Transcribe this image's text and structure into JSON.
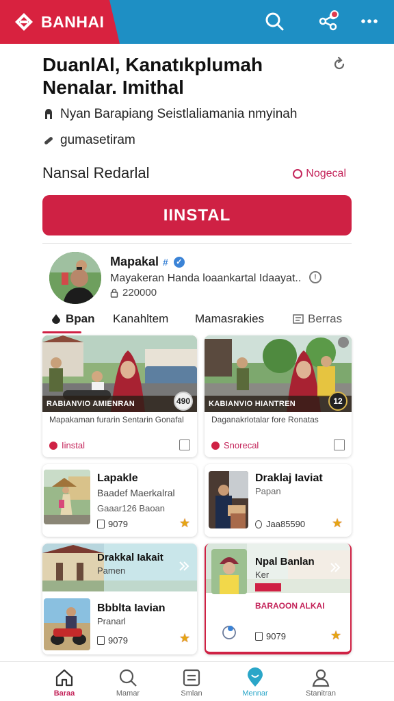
{
  "app": {
    "brand": "BANHAI",
    "accent": "#cf2144",
    "header_blue": "#1e8fc4"
  },
  "header_icons": [
    "search-icon",
    "share-icon",
    "more-icon"
  ],
  "headline": {
    "line1": "DuanlAl, Kanatıkplumah",
    "line2": "Nenalar. Imithal"
  },
  "meta": {
    "author": "Nyan Barapiang Seistlaliamania nmyinah",
    "tag": "gumasetiram"
  },
  "section": {
    "label": "Nansal Redarlal",
    "link": "Nogecal"
  },
  "install_label": "IINSTAL",
  "profile": {
    "name": "Mapakal",
    "description": "Mayakeran Handa loaankartal Idaayat..",
    "count": "220000"
  },
  "tabs": [
    {
      "label": "Bpan",
      "active": true
    },
    {
      "label": "Kanahltem"
    },
    {
      "label": "Mamasrakies"
    },
    {
      "label": "Berras"
    }
  ],
  "feature_cards": [
    {
      "banner": "RABIANVIO AMIENRAN",
      "badge": "490",
      "text": "Mapakaman furarin Sentarin Gonafal",
      "action": "Iinstal"
    },
    {
      "banner": "KABIANVIO HIANTREN",
      "badge": "12",
      "text": "Daganakrlotalar fore Ronatas",
      "action": "Snorecal"
    }
  ],
  "list_cards": [
    {
      "title": "Lapakle",
      "subtitle": "Baadef Maerkalral",
      "sub2": "Gaaar126 Baoan",
      "stat": "9079"
    },
    {
      "title": "Draklaj Iaviat",
      "subtitle": "Papan",
      "stat": "Jaa85590"
    },
    {
      "title": "Drakkal Iakait",
      "subtitle": "Pamen"
    },
    {
      "title": "Npal Banlan",
      "subtitle": "Ker",
      "tag": "",
      "pink": "BARAOON ALKAI",
      "stat": "9079"
    },
    {
      "title": "Bbblta Iavian",
      "subtitle": "Pranarl",
      "stat": "9079"
    }
  ],
  "bottom_nav": [
    {
      "label": "Baraa",
      "icon": "home-icon",
      "active": true
    },
    {
      "label": "Mamar",
      "icon": "search-icon"
    },
    {
      "label": "Smlan",
      "icon": "inbox-icon"
    },
    {
      "label": "Mennar",
      "icon": "location-icon"
    },
    {
      "label": "Stanitran",
      "icon": "profile-icon"
    }
  ]
}
